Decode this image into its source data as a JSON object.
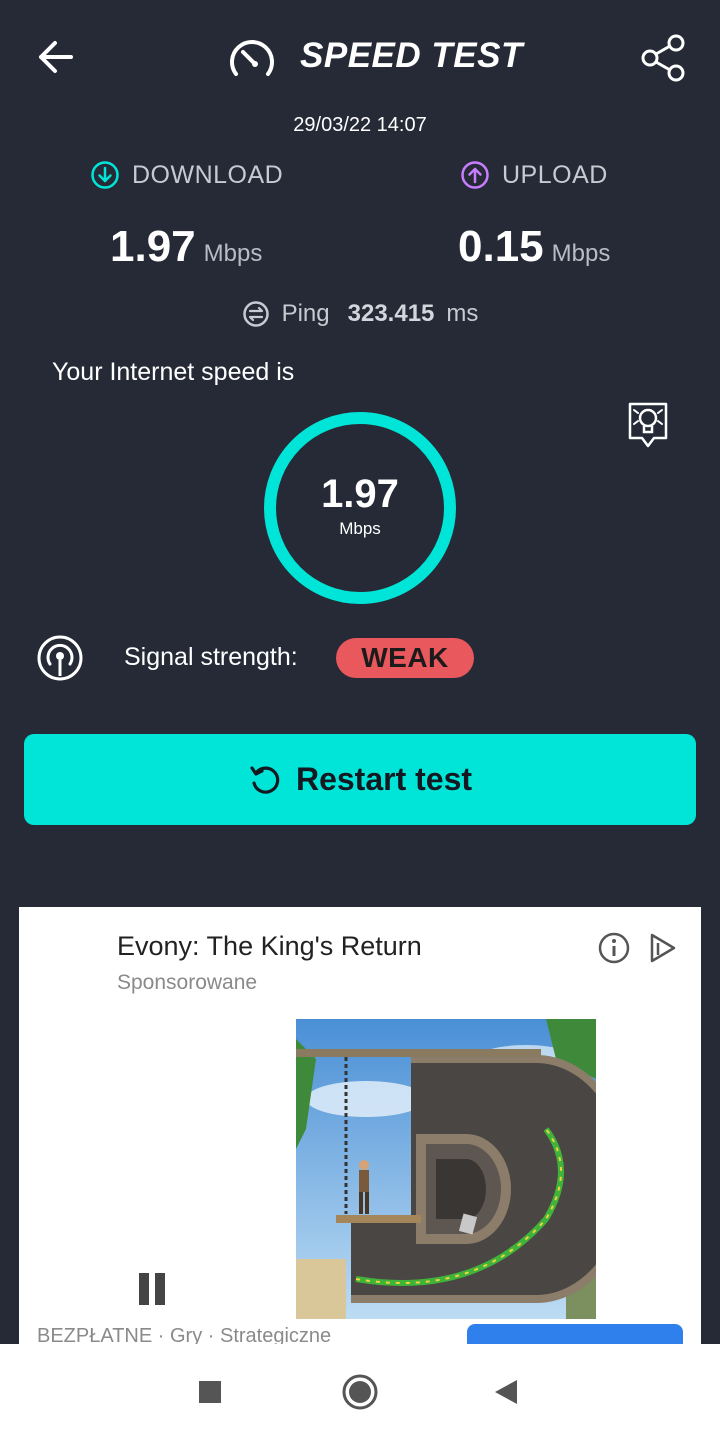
{
  "header": {
    "title": "SPEED TEST",
    "back_icon": "arrow-left-icon",
    "share_icon": "share-icon",
    "logo_icon": "speedometer-icon"
  },
  "result": {
    "datetime": "29/03/22 14:07",
    "download": {
      "label": "DOWNLOAD",
      "value": "1.97",
      "unit": "Mbps",
      "color": "#00e5d8"
    },
    "upload": {
      "label": "UPLOAD",
      "value": "0.15",
      "unit": "Mbps",
      "color": "#c77dff"
    },
    "ping": {
      "label": "Ping",
      "value": "323.415",
      "unit": "ms"
    },
    "speed_caption": "Your Internet speed is",
    "gauge": {
      "value": "1.97",
      "unit": "Mbps"
    },
    "signal": {
      "label": "Signal strength:",
      "value": "WEAK",
      "color": "#e8585d"
    },
    "restart_label": "Restart test"
  },
  "ad": {
    "title": "Evony: The King's Return",
    "sponsored": "Sponsorowane",
    "footer": "BEZPŁATNE · Gry · Strategiczne",
    "cta_color": "#2f80ed"
  },
  "colors": {
    "background": "#252a36",
    "accent": "#00e5d8"
  }
}
